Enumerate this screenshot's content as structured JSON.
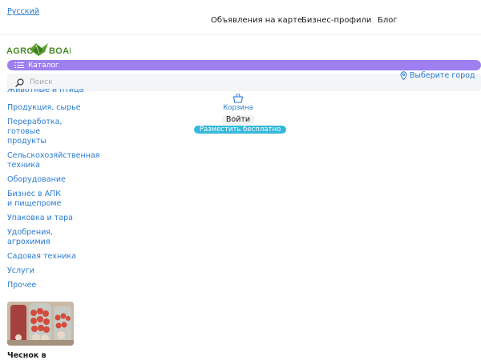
{
  "header": {
    "language": "Русский",
    "nav": [
      {
        "label": "Объявления на карте"
      },
      {
        "label": "Бизнес-профили"
      },
      {
        "label": "Блог"
      }
    ],
    "logo_text_left": "AGRO",
    "logo_text_right": "BOARD"
  },
  "catalog": {
    "button_label": "Каталог"
  },
  "search": {
    "placeholder": "Поиск"
  },
  "city": {
    "label": "Выберите город"
  },
  "categories": [
    "Животные и птица",
    "Продукция, сырье",
    "Переработка, готовые продукты",
    "Сельскохозяйственная техника",
    "Оборудование",
    "Бизнес в АПК и пищепроме",
    "Упаковка и тара",
    "Удобрения, агрохимия",
    "Садовая техника",
    "Услуги",
    "Прочее"
  ],
  "actions": {
    "cart_label": "Корзина",
    "login_label": "Войти",
    "post_label": "Разместить бесплатно"
  },
  "product": {
    "title": "Чеснок в"
  },
  "colors": {
    "link": "#2a7bd4",
    "catalog_bg": "#9d7ff0",
    "post_bg": "#35b8dc",
    "logo_green": "#4a8a2a"
  }
}
